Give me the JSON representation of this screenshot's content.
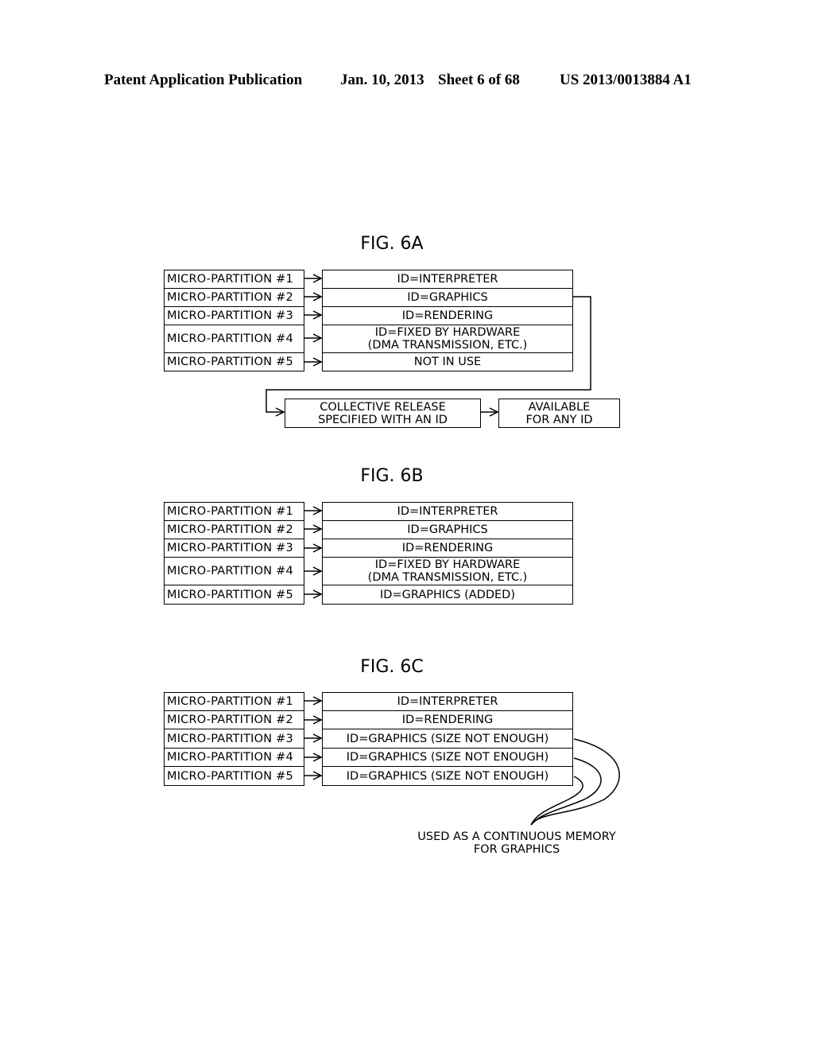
{
  "header": {
    "publication": "Patent Application Publication",
    "date": "Jan. 10, 2013",
    "sheet": "Sheet 6 of 68",
    "number": "US 2013/0013884 A1"
  },
  "fig6a": {
    "title": "FIG. 6A",
    "partitions": [
      "MICRO-PARTITION #1",
      "MICRO-PARTITION #2",
      "MICRO-PARTITION #3",
      "MICRO-PARTITION #4",
      "MICRO-PARTITION #5"
    ],
    "ids": [
      {
        "line1": "ID=INTERPRETER",
        "line2": ""
      },
      {
        "line1": "ID=GRAPHICS",
        "line2": ""
      },
      {
        "line1": "ID=RENDERING",
        "line2": ""
      },
      {
        "line1": "ID=FIXED BY HARDWARE",
        "line2": "(DMA TRANSMISSION, ETC.)"
      },
      {
        "line1": "NOT IN USE",
        "line2": ""
      }
    ],
    "release": {
      "line1": "COLLECTIVE RELEASE",
      "line2": "SPECIFIED WITH AN ID"
    },
    "available": {
      "line1": "AVAILABLE",
      "line2": "FOR ANY ID"
    }
  },
  "fig6b": {
    "title": "FIG. 6B",
    "partitions": [
      "MICRO-PARTITION #1",
      "MICRO-PARTITION #2",
      "MICRO-PARTITION #3",
      "MICRO-PARTITION #4",
      "MICRO-PARTITION #5"
    ],
    "ids": [
      {
        "line1": "ID=INTERPRETER",
        "line2": ""
      },
      {
        "line1": "ID=GRAPHICS",
        "line2": ""
      },
      {
        "line1": "ID=RENDERING",
        "line2": ""
      },
      {
        "line1": "ID=FIXED BY HARDWARE",
        "line2": "(DMA TRANSMISSION, ETC.)"
      },
      {
        "line1": "ID=GRAPHICS (ADDED)",
        "line2": ""
      }
    ]
  },
  "fig6c": {
    "title": "FIG. 6C",
    "partitions": [
      "MICRO-PARTITION #1",
      "MICRO-PARTITION #2",
      "MICRO-PARTITION #3",
      "MICRO-PARTITION #4",
      "MICRO-PARTITION #5"
    ],
    "ids": [
      "ID=INTERPRETER",
      "ID=RENDERING",
      "ID=GRAPHICS (SIZE NOT ENOUGH)",
      "ID=GRAPHICS (SIZE NOT ENOUGH)",
      "ID=GRAPHICS (SIZE NOT ENOUGH)"
    ],
    "note": {
      "line1": "USED AS A CONTINUOUS MEMORY",
      "line2": "FOR GRAPHICS"
    }
  }
}
